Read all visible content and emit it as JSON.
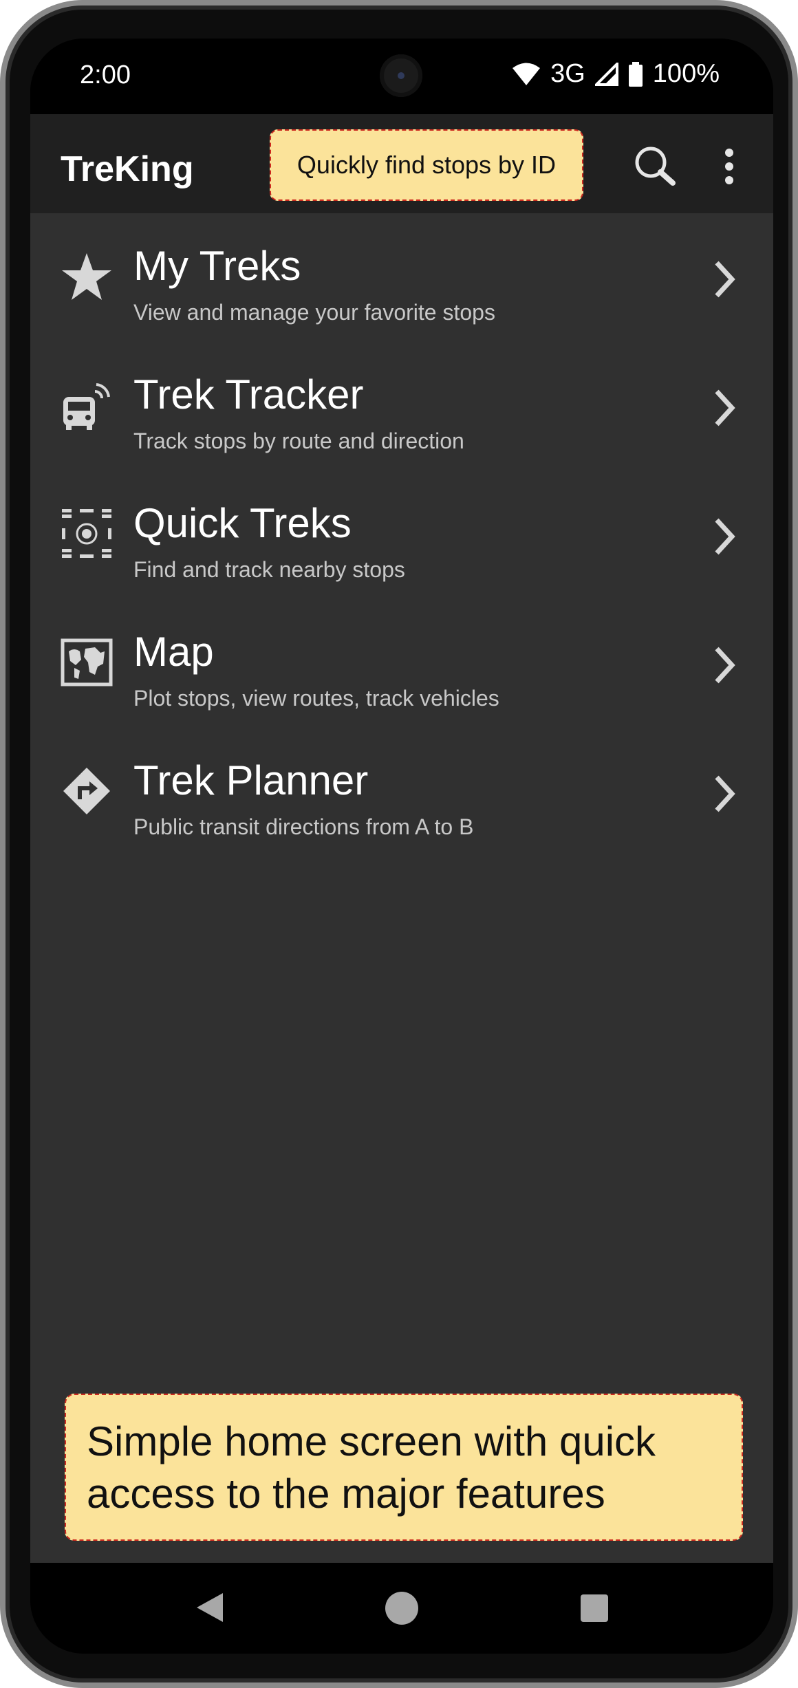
{
  "status_bar": {
    "time": "2:00",
    "network": "3G",
    "battery": "100%"
  },
  "app_bar": {
    "title": "TreKing",
    "tooltip": "Quickly find stops by ID",
    "search_icon": "search-icon",
    "menu_icon": "more-vert-icon"
  },
  "menu": {
    "items": [
      {
        "title": "My Treks",
        "subtitle": "View and manage your favorite stops",
        "icon": "star-icon"
      },
      {
        "title": "Trek Tracker",
        "subtitle": "Track stops by route and direction",
        "icon": "bus-tracker-icon"
      },
      {
        "title": "Quick Treks",
        "subtitle": "Find and track nearby stops",
        "icon": "nearby-stops-icon"
      },
      {
        "title": "Map",
        "subtitle": "Plot stops, view routes, track vehicles",
        "icon": "map-icon"
      },
      {
        "title": "Trek Planner",
        "subtitle": "Public transit directions from A to B",
        "icon": "directions-icon"
      }
    ]
  },
  "banner": {
    "text": "Simple home screen with quick access to the major features"
  },
  "colors": {
    "background": "#303030",
    "appbar": "#202020",
    "tooltip": "#fbe39a",
    "tooltip_border": "#cc2a1f"
  }
}
